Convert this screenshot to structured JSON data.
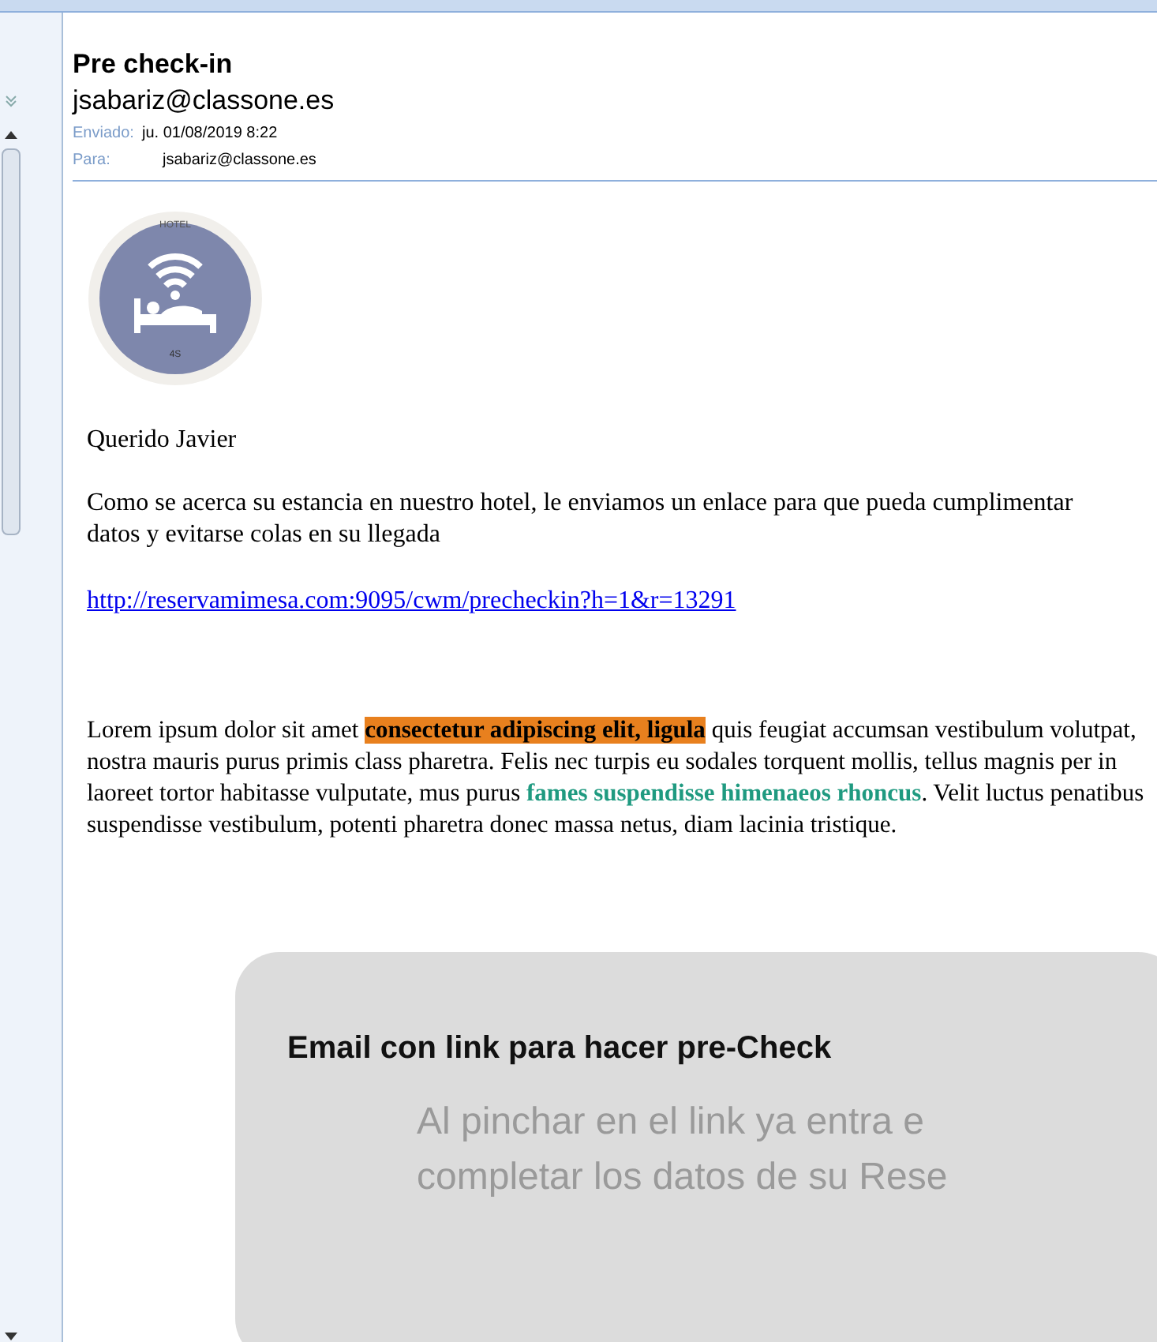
{
  "message": {
    "subject": "Pre check-in",
    "sender": "jsabariz@classone.es",
    "sent_label": "Enviado:",
    "sent_value": "ju. 01/08/2019 8:22",
    "to_label": "Para:",
    "to_value": "jsabariz@classone.es"
  },
  "logo": {
    "top_text": "HOTEL",
    "bottom_text": "4S"
  },
  "body": {
    "greeting": "Querido Javier",
    "intro": "Como se acerca su estancia en nuestro hotel, le enviamos un enlace para que pueda cumplimentar datos y evitarse colas en su llegada",
    "link": "http://reservamimesa.com:9095/cwm/precheckin?h=1&r=13291",
    "paragraph": [
      {
        "kind": "plain",
        "text": "Lorem ipsum dolor sit amet "
      },
      {
        "kind": "highlight",
        "text": "consectetur adipiscing elit, ligula"
      },
      {
        "kind": "plain",
        "text": " quis feugiat accumsan vestibulum volutpat, nostra mauris purus primis class pharetra. Felis nec turpis eu sodales torquent mollis, tellus magnis per in laoreet tortor habitasse vulputate, mus purus "
      },
      {
        "kind": "accent",
        "text": "fames suspendisse himenaeos rhoncus"
      },
      {
        "kind": "plain",
        "text": ". Velit luctus penatibus suspendisse vestibulum, potenti pharetra donec massa netus, diam lacinia tristique."
      }
    ]
  },
  "callout": {
    "title": "Email con link para hacer pre-Check",
    "lines": [
      "Al pinchar en el link ya entra e",
      "completar los datos de su Rese"
    ]
  }
}
